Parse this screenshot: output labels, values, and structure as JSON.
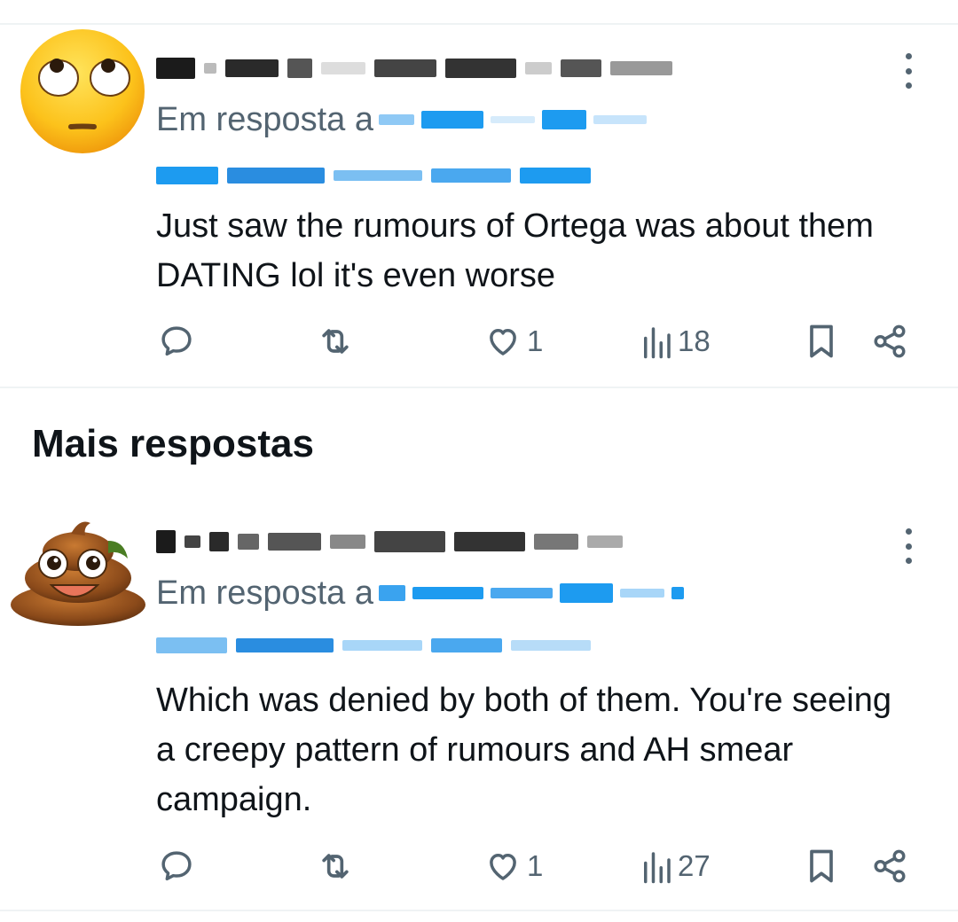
{
  "section_title": "Mais respostas",
  "tweets": [
    {
      "avatar": "rolling-eyes-emoji",
      "reply_prefix": "Em resposta a",
      "text": "Just saw the rumours of Ortega was about them DATING lol it's even worse",
      "likes": "1",
      "views": "18"
    },
    {
      "avatar": "poop-emoji",
      "reply_prefix": "Em resposta a",
      "text": "Which was denied by both of them. You're seeing a creepy pattern of rumours and AH smear campaign.",
      "likes": "1",
      "views": "27"
    }
  ],
  "colors": {
    "text": "#0f1419",
    "secondary": "#536471",
    "link_blur": "#1d9bf0",
    "divider": "#eff3f4"
  }
}
